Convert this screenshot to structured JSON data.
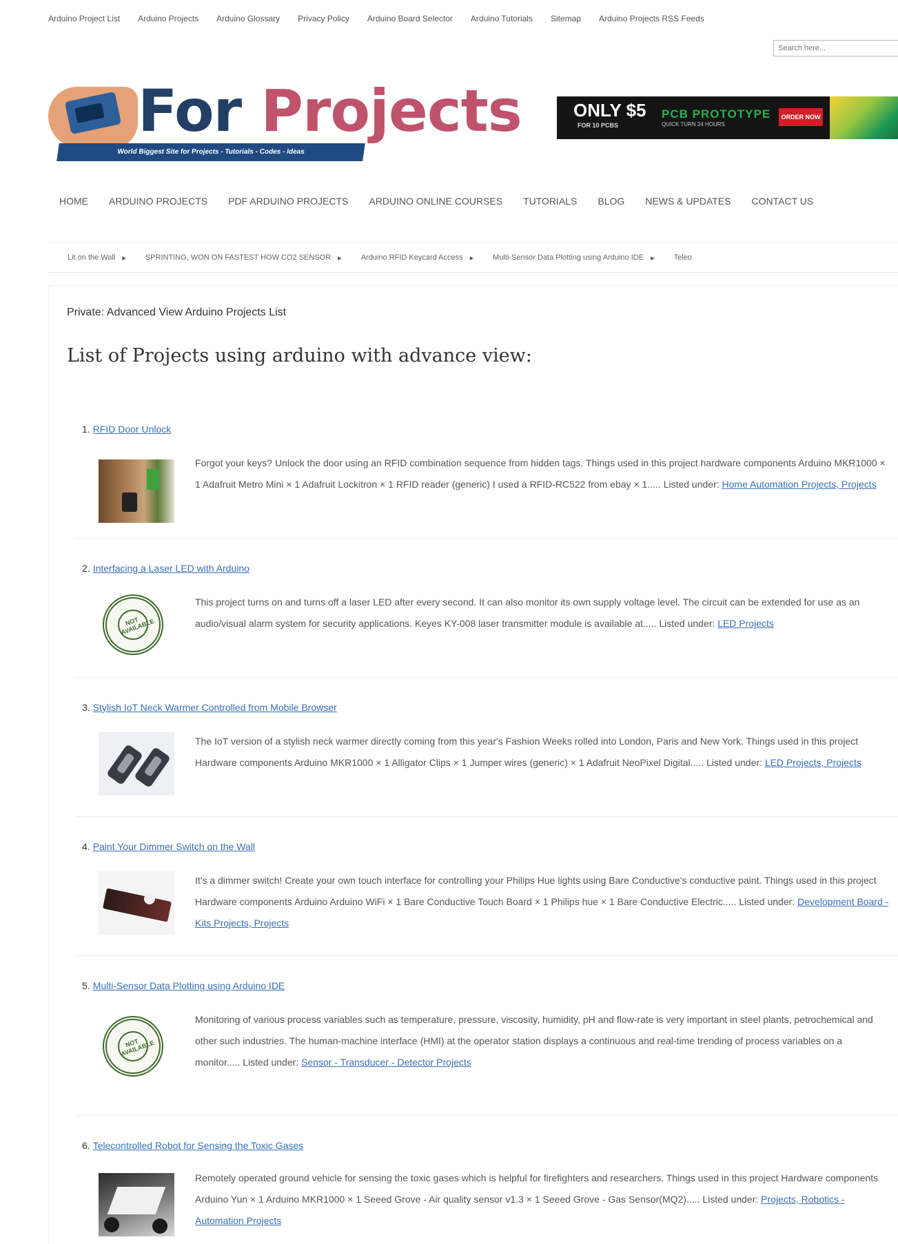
{
  "top_nav": [
    "Arduino Project List",
    "Arduino Projects",
    "Arduino Glossary",
    "Privacy Policy",
    "Arduino Board Selector",
    "Arduino Tutorials",
    "Sitemap",
    "Arduino Projects RSS Feeds"
  ],
  "search": {
    "placeholder": "Search here..."
  },
  "logo": {
    "word1": "For",
    "word2": "Projects",
    "tagline": "World Biggest Site for Projects - Tutorials - Codes - Ideas"
  },
  "banner": {
    "headline": "ONLY $5",
    "subline": "FOR 10 PCBS",
    "brand": "PCB PROTOTYPE",
    "brand_sub": "QUICK TURN 24 HOURS",
    "cta": "ORDER NOW"
  },
  "main_nav": [
    "HOME",
    "ARDUINO PROJECTS",
    "PDF ARDUINO PROJECTS",
    "ARDUINO ONLINE COURSES",
    "TUTORIALS",
    "BLOG",
    "NEWS & UPDATES",
    "CONTACT US"
  ],
  "ticker": [
    "Lit on the Wall",
    "SPRINTING, WON ON FASTEST HOW CO2 SENSOR",
    "Arduino RFID Keycard Access",
    "Multi-Sensor Data Plotting using Arduino IDE",
    "Teleo"
  ],
  "ticker_separator": "▸",
  "page": {
    "private_title": "Private: Advanced View Arduino Projects List",
    "heading": "List of Projects using arduino with advance view:"
  },
  "listed_under_label": "Listed under:",
  "projects": [
    {
      "number": "1.",
      "title": "RFID Door Unlock",
      "description": "Forgot your keys? Unlock the door using an RFID combination sequence from hidden tags. Things used in this project hardware components Arduino MKR1000 × 1 Adafruit Metro Mini × 1 Adafruit Lockitron × 1 RFID reader (generic) I used a RFID-RC522 from ebay × 1..... ",
      "categories": "Home Automation Projects, Projects"
    },
    {
      "number": "2.",
      "title": "Interfacing a Laser LED with Arduino",
      "description": "This project turns on and turns off a laser LED after every second. It can also monitor its own supply voltage level. The circuit can be extended for use as an audio/visual alarm system for security applications. Keyes KY-008 laser transmitter module is available at..... ",
      "categories": "LED Projects",
      "seal_text": "NOT AVAILABLE"
    },
    {
      "number": "3.",
      "title": "Stylish IoT Neck Warmer Controlled from Mobile Browser",
      "description": "The IoT version of a stylish neck warmer directly coming from this year's Fashion Weeks rolled into London, Paris and New York. Things used in this project Hardware components Arduino MKR1000 × 1 Alligator Clips × 1 Jumper wires (generic) × 1 Adafruit NeoPixel Digital..... ",
      "categories": "LED Projects, Projects"
    },
    {
      "number": "4.",
      "title": "Paint Your Dimmer Switch on the Wall",
      "description": "It's a dimmer switch! Create your own touch interface for controlling your Philips Hue lights using Bare Conductive's conductive paint. Things used in this project Hardware components Arduino Arduino WiFi × 1 Bare Conductive Touch Board × 1 Philips hue × 1 Bare Conductive Electric..... ",
      "categories": "Development Board - Kits Projects, Projects"
    },
    {
      "number": "5.",
      "title": "Multi-Sensor Data Plotting using Arduino IDE",
      "description": "Monitoring of various process variables such as temperature, pressure, viscosity, humidity, pH and flow-rate is very important in steel plants, petrochemical and other such industries. The human-machine interface (HMI) at the operator station displays a continuous and real-time trending of process variables on a monitor..... ",
      "categories": "Sensor - Transducer - Detector Projects",
      "seal_text": "NOT AVAILABLE"
    },
    {
      "number": "6.",
      "title": "Telecontrolled Robot for Sensing the Toxic Gases",
      "description": "Remotely operated ground vehicle for sensing the toxic gases which is helpful for firefighters and researchers. Things used in this project Hardware components Arduino Yun × 1 Arduino MKR1000 × 1 Seeed Grove - Air quality sensor v1.3 × 1 Seeed Grove - Gas Sensor(MQ2)..... ",
      "categories": "Projects, Robotics - Automation Projects"
    }
  ]
}
